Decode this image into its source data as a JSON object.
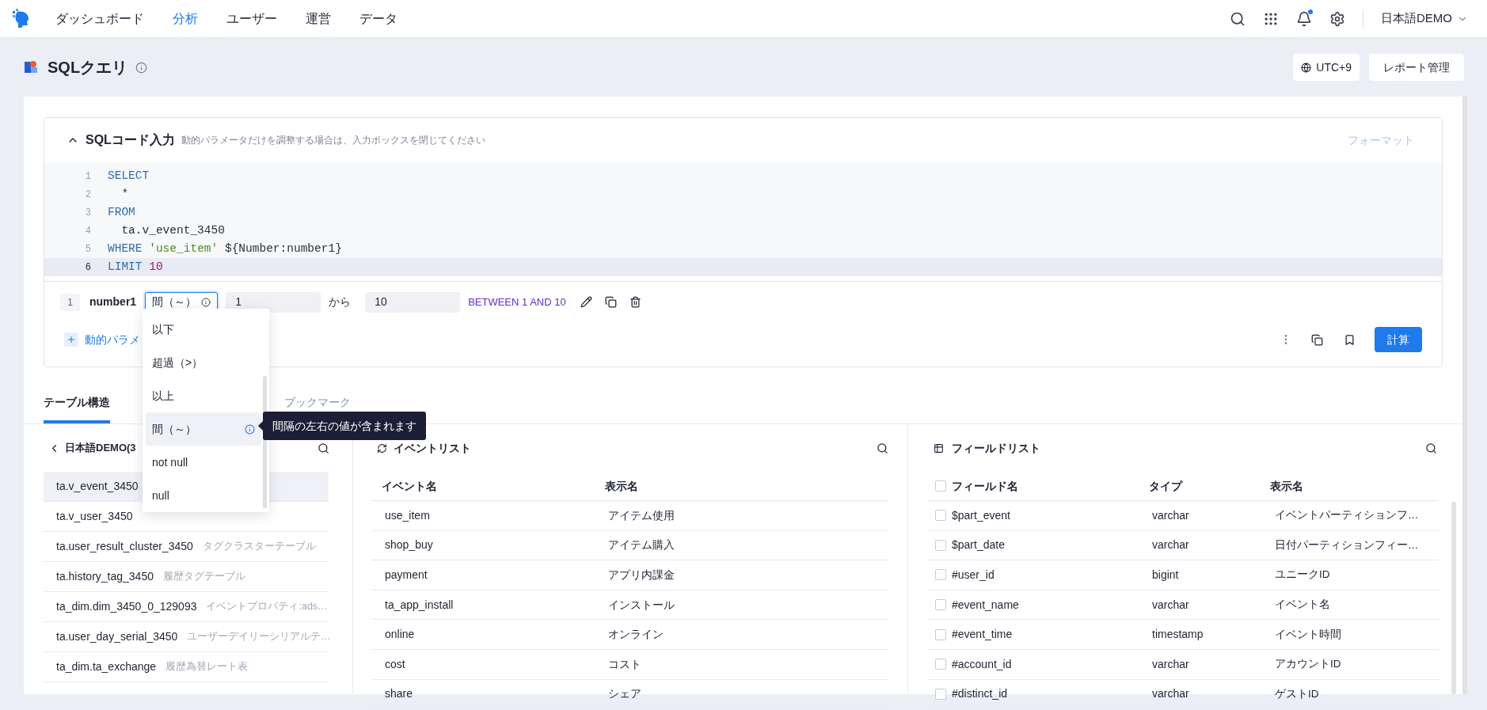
{
  "nav": {
    "items": [
      {
        "label": "ダッシュボード",
        "selected": false
      },
      {
        "label": "分析",
        "selected": true
      },
      {
        "label": "ユーザー",
        "selected": false
      },
      {
        "label": "運営",
        "selected": false
      },
      {
        "label": "データ",
        "selected": false
      }
    ],
    "account": "日本語DEMO"
  },
  "page": {
    "title": "SQLクエリ",
    "timezone": "UTC+9",
    "report_button": "レポート管理"
  },
  "sql_panel": {
    "title": "SQLコード入力",
    "expanded": true,
    "hint": "動的パラメータだけを調整する場合は、入力ボックスを閉じてください",
    "format_button": "フォーマット",
    "lines": [
      {
        "number": "1",
        "current": false,
        "tokens": [
          {
            "kind": "keyword",
            "text": "SELECT"
          }
        ]
      },
      {
        "number": "2",
        "current": false,
        "tokens": [
          {
            "kind": "plain",
            "text": "  *"
          }
        ]
      },
      {
        "number": "3",
        "current": false,
        "tokens": [
          {
            "kind": "keyword",
            "text": "FROM"
          }
        ]
      },
      {
        "number": "4",
        "current": false,
        "tokens": [
          {
            "kind": "plain",
            "text": "  ta.v_event_3450"
          }
        ]
      },
      {
        "number": "5",
        "current": false,
        "tokens": [
          {
            "kind": "keyword",
            "text": "WHERE "
          },
          {
            "kind": "string",
            "text": "'use_item'"
          },
          {
            "kind": "plain",
            "text": " ${Number:number1}"
          }
        ]
      },
      {
        "number": "6",
        "current": true,
        "tokens": [
          {
            "kind": "keyword",
            "text": "LIMIT "
          },
          {
            "kind": "number",
            "text": "10"
          }
        ]
      }
    ]
  },
  "parameter": {
    "index": "1",
    "name": "number1",
    "operator": "間（～）",
    "from": "1",
    "connector": "から",
    "to": "10",
    "preview": "BETWEEN 1 AND 10"
  },
  "add_parameter": "動的パラメ",
  "run_button": "計算",
  "operator_menu": {
    "items": [
      {
        "label": "以下",
        "selected": false
      },
      {
        "label": "超過（>）",
        "selected": false
      },
      {
        "label": "以上",
        "selected": false
      },
      {
        "label": "間（～）",
        "selected": true
      },
      {
        "label": "not null",
        "selected": false
      },
      {
        "label": "null",
        "selected": false
      }
    ],
    "tooltip": "間隔の左右の値が含まれます"
  },
  "tabs": [
    {
      "label": "テーブル構造",
      "selected": true
    },
    {
      "label": "ブックマーク",
      "selected": false
    }
  ],
  "database": {
    "title": "日本語DEMO(3",
    "tables": [
      {
        "name": "ta.v_event_3450",
        "selected": true
      },
      {
        "name": "ta.v_user_3450",
        "selected": false
      },
      {
        "name": "ta.user_result_cluster_3450",
        "description": "タグクラスターテーブル",
        "selected": false
      },
      {
        "name": "ta.history_tag_3450",
        "description": "履歴タグテーブル",
        "selected": false
      },
      {
        "name": "ta_dim.dim_3450_0_129093",
        "description": "イベントプロパティ:ads…",
        "selected": false
      },
      {
        "name": "ta.user_day_serial_3450",
        "description": "ユーザーデイリーシリアルテ…",
        "selected": false
      },
      {
        "name": "ta_dim.ta_exchange",
        "description": "履歴為替レート表",
        "selected": false
      }
    ]
  },
  "event_list": {
    "title": "イベントリスト",
    "columns": [
      "イベント名",
      "表示名"
    ],
    "rows": [
      [
        "use_item",
        "アイテム使用"
      ],
      [
        "shop_buy",
        "アイテム購入"
      ],
      [
        "payment",
        "アプリ内課金"
      ],
      [
        "ta_app_install",
        "インストール"
      ],
      [
        "online",
        "オンライン"
      ],
      [
        "cost",
        "コスト"
      ],
      [
        "share",
        "シェア"
      ]
    ]
  },
  "field_list": {
    "title": "フィールドリスト",
    "columns": [
      "フィールド名",
      "タイプ",
      "表示名"
    ],
    "all_checked": false,
    "rows": [
      {
        "name": "$part_event",
        "type": "varchar",
        "display": "イベントパーティションフ…",
        "checked": false
      },
      {
        "name": "$part_date",
        "type": "varchar",
        "display": "日付パーティションフィー…",
        "checked": false
      },
      {
        "name": "#user_id",
        "type": "bigint",
        "display": "ユニークID",
        "checked": false
      },
      {
        "name": "#event_name",
        "type": "varchar",
        "display": "イベント名",
        "checked": false
      },
      {
        "name": "#event_time",
        "type": "timestamp",
        "display": "イベント時間",
        "checked": false
      },
      {
        "name": "#account_id",
        "type": "varchar",
        "display": "アカウントID",
        "checked": false
      },
      {
        "name": "#distinct_id",
        "type": "varchar",
        "display": "ゲストID",
        "checked": false
      }
    ]
  }
}
